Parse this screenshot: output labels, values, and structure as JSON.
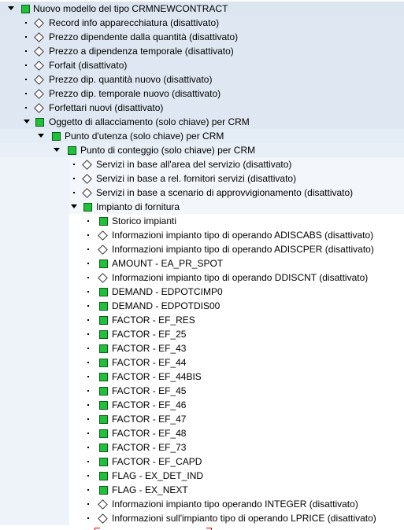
{
  "tree": [
    {
      "label": "Nuovo modello del tipo CRMNEWCONTRACT",
      "icon": "node-green",
      "expanded": true,
      "level": 0
    },
    {
      "label": "Record info apparecchiatura (disattivato)",
      "icon": "leaf-diamond",
      "level": 1
    },
    {
      "label": "Prezzo dipendente dalla quantità (disattivato)",
      "icon": "leaf-diamond",
      "level": 1
    },
    {
      "label": "Prezzo a dipendenza temporale (disattivato)",
      "icon": "leaf-diamond",
      "level": 1
    },
    {
      "label": "Forfait (disattivato)",
      "icon": "leaf-diamond",
      "level": 1
    },
    {
      "label": "Prezzo dip. quantità nuovo (disattivato)",
      "icon": "leaf-diamond",
      "level": 1
    },
    {
      "label": "Prezzo dip. temporale nuovo (disattivato)",
      "icon": "leaf-diamond",
      "level": 1
    },
    {
      "label": "Forfettari nuovi (disattivato)",
      "icon": "leaf-diamond",
      "level": 1
    },
    {
      "label": "Oggetto di allacciamento (solo chiave) per CRM",
      "icon": "node-green",
      "expanded": true,
      "level": 1
    },
    {
      "label": "Punto d'utenza (solo chiave) per CRM",
      "icon": "node-green",
      "expanded": true,
      "level": 2
    },
    {
      "label": "Punto di conteggio (solo chiave) per CRM",
      "icon": "node-green",
      "expanded": true,
      "level": 3
    },
    {
      "label": "Servizi in base all'area del servizio (disattivato)",
      "icon": "leaf-diamond",
      "level": 4
    },
    {
      "label": "Servizi in base a rel. fornitori servizi (disattivato)",
      "icon": "leaf-diamond",
      "level": 4
    },
    {
      "label": "Servizi in base a scenario di approvvigionamento (disattivato)",
      "icon": "leaf-diamond",
      "level": 4
    },
    {
      "label": "Impianto di fornitura",
      "icon": "node-green",
      "expanded": true,
      "level": 4
    },
    {
      "label": "Storico impianti",
      "icon": "node-green",
      "level": 5
    },
    {
      "label": "Informazioni impianto tipo di operando ADISCABS (disattivato)",
      "icon": "leaf-diamond",
      "level": 5
    },
    {
      "label": "Informazioni impianto tipo di operando ADISCPER (disattivato)",
      "icon": "leaf-diamond",
      "level": 5
    },
    {
      "label": "AMOUNT - EA_PR_SPOT",
      "icon": "node-green",
      "level": 5
    },
    {
      "label": "Informazioni impianto tipo di operando DDISCNT (disattivato)",
      "icon": "leaf-diamond",
      "level": 5
    },
    {
      "label": "DEMAND - EDPOTCIMP0",
      "icon": "node-green",
      "level": 5
    },
    {
      "label": "DEMAND - EDPOTDIS00",
      "icon": "node-green",
      "level": 5
    },
    {
      "label": "FACTOR - EF_RES",
      "icon": "node-green",
      "level": 5
    },
    {
      "label": "FACTOR - EF_25",
      "icon": "node-green",
      "level": 5
    },
    {
      "label": "FACTOR - EF_43",
      "icon": "node-green",
      "level": 5
    },
    {
      "label": "FACTOR - EF_44",
      "icon": "node-green",
      "level": 5
    },
    {
      "label": "FACTOR - EF_44BIS",
      "icon": "node-green",
      "level": 5
    },
    {
      "label": "FACTOR - EF_45",
      "icon": "node-green",
      "level": 5
    },
    {
      "label": "FACTOR - EF_46",
      "icon": "node-green",
      "level": 5
    },
    {
      "label": "FACTOR - EF_47",
      "icon": "node-green",
      "level": 5
    },
    {
      "label": "FACTOR - EF_48",
      "icon": "node-green",
      "level": 5
    },
    {
      "label": "FACTOR - EF_73",
      "icon": "node-green",
      "level": 5
    },
    {
      "label": "FACTOR - EF_CAPD",
      "icon": "node-green",
      "level": 5
    },
    {
      "label": "FLAG - EX_DET_IND",
      "icon": "node-green",
      "level": 5
    },
    {
      "label": "FLAG - EX_NEXT",
      "icon": "node-green",
      "level": 5
    },
    {
      "label": "Informazioni impianto tipo operando INTEGER (disattivato)",
      "icon": "leaf-diamond",
      "level": 5
    },
    {
      "label": "Informazioni sull'impianto tipo di operando LPRICE (disattivato)",
      "icon": "leaf-diamond",
      "level": 5
    }
  ],
  "colors": {
    "node_green": "#1fc13a",
    "band_level0": "#dce6f1",
    "band_level4": "#f0f4f9"
  }
}
